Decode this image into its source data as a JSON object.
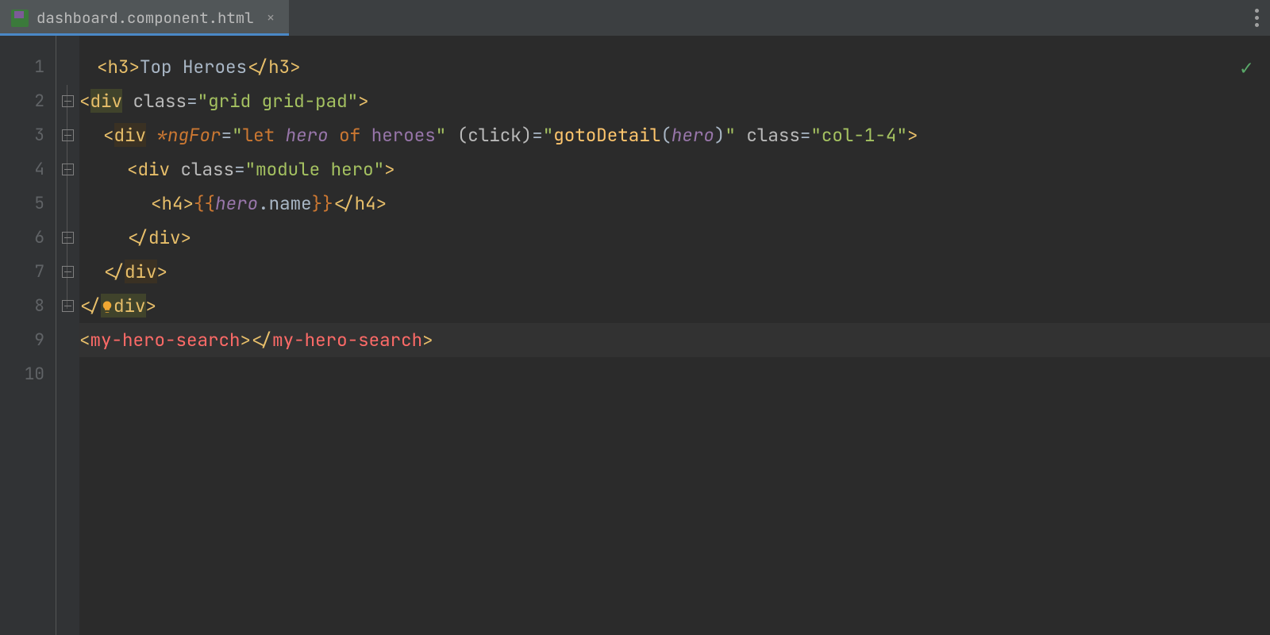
{
  "tab": {
    "filename": "dashboard.component.html"
  },
  "gutter": {
    "numbers": [
      "1",
      "2",
      "3",
      "4",
      "5",
      "6",
      "7",
      "8",
      "9",
      "10"
    ]
  },
  "status": {
    "checkmark": "✓"
  },
  "code": {
    "l1": {
      "tag": "h3",
      "text": "Top Heroes"
    },
    "l2": {
      "tag": "div",
      "attr": "class",
      "val": "grid grid-pad"
    },
    "l3": {
      "tag": "div",
      "ngfor": "*ngFor",
      "let": "let",
      "hero": "hero",
      "of": "of",
      "coll": "heroes",
      "evt": "(click)",
      "fn": "gotoDetail",
      "arg": "hero",
      "attr2": "class",
      "val2": "col-1-4"
    },
    "l4": {
      "tag": "div",
      "attr": "class",
      "val": "module hero"
    },
    "l5": {
      "tag": "h4",
      "hero": "hero",
      "prop": ".name"
    },
    "l6": {
      "tag": "div"
    },
    "l7": {
      "tag": "div"
    },
    "l8": {
      "tag": "div"
    },
    "l9": {
      "tag": "my-hero-search"
    }
  }
}
